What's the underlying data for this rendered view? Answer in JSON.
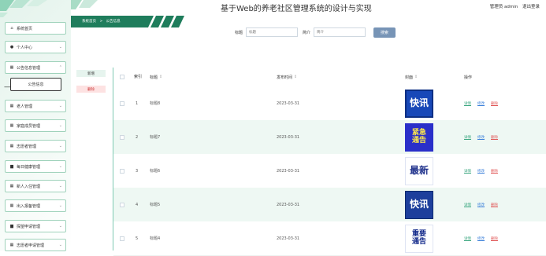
{
  "header": {
    "title": "基于Web的养老社区管理系统的设计与实现",
    "user_role": "管理员",
    "username": "admin",
    "logout": "退出登录"
  },
  "breadcrumb": {
    "home": "系统首页",
    "sep": ">",
    "current": "公告信息"
  },
  "sidebar": {
    "items": [
      {
        "label": "系统首页",
        "icon": "home-icon"
      },
      {
        "label": "个人中心",
        "icon": "user-icon"
      },
      {
        "label": "公告信息管理",
        "icon": "grid-icon"
      },
      {
        "label": "老人管理",
        "icon": "grid-icon"
      },
      {
        "label": "家庭成员管理",
        "icon": "grid-icon"
      },
      {
        "label": "志愿者管理",
        "icon": "grid-icon"
      },
      {
        "label": "每日健康管理",
        "icon": "folder-icon"
      },
      {
        "label": "新人入住管理",
        "icon": "grid-icon"
      },
      {
        "label": "出入报备管理",
        "icon": "grid-icon"
      },
      {
        "label": "探望申请管理",
        "icon": "folder-icon"
      },
      {
        "label": "志愿者申请管理",
        "icon": "grid-icon"
      }
    ],
    "sub_item": "公告信息"
  },
  "search": {
    "title_label": "标题",
    "title_placeholder": "标题",
    "intro_label": "简介",
    "intro_placeholder": "简介",
    "button": "搜索"
  },
  "actions": {
    "add": "新增",
    "delete": "删除"
  },
  "table": {
    "headers": {
      "index": "索引",
      "title": "标题",
      "date": "发布时间",
      "cover": "封面",
      "ops": "操作"
    },
    "rows": [
      {
        "index": "1",
        "title": "标题8",
        "date": "2023-03-31",
        "cover": [
          "快讯"
        ]
      },
      {
        "index": "2",
        "title": "标题7",
        "date": "2023-03-31",
        "cover": [
          "紧急",
          "通告"
        ]
      },
      {
        "index": "3",
        "title": "标题6",
        "date": "2023-03-31",
        "cover": [
          "最新"
        ]
      },
      {
        "index": "4",
        "title": "标题5",
        "date": "2023-03-31",
        "cover": [
          "快讯"
        ]
      },
      {
        "index": "5",
        "title": "标题4",
        "date": "2023-03-31",
        "cover": [
          "重要",
          "通告"
        ]
      }
    ],
    "row_actions": {
      "detail": "详情",
      "edit": "修改",
      "delete": "删除"
    }
  },
  "colors": {
    "accent_green": "#7fcab2",
    "row_alt": "#eef8f3",
    "search_button": "#7794b6",
    "detail_link": "#3aa67f",
    "edit_link": "#3a7fd9",
    "delete_link": "#e05656",
    "cover_blue": "#1e50c6"
  }
}
